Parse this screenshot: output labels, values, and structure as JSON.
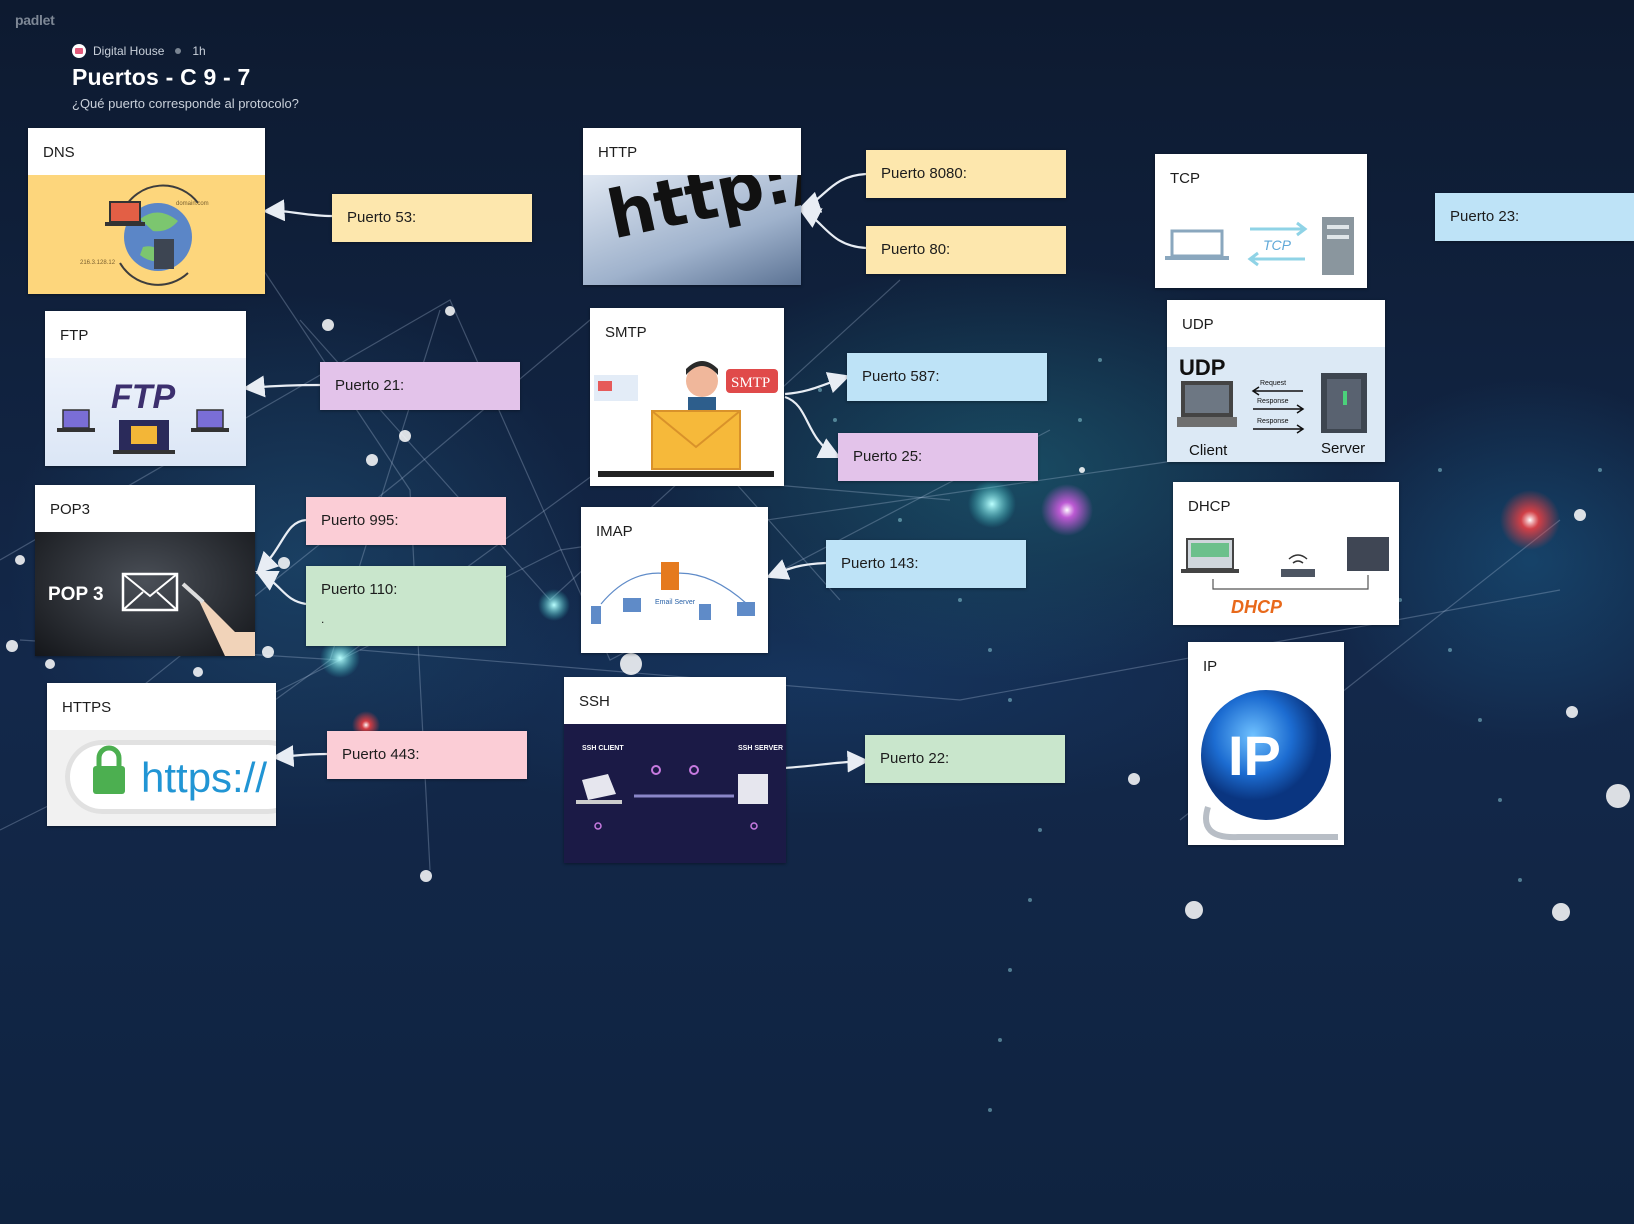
{
  "app": {
    "logo": "padlet"
  },
  "header": {
    "author": "Digital House",
    "time": "1h",
    "title": "Puertos - C 9 - 7",
    "subtitle": "¿Qué puerto corresponde al protocolo?"
  },
  "cards": {
    "dns": {
      "title": "DNS",
      "img_domain": "domain.com",
      "img_ip": "216.3.128.12"
    },
    "http": {
      "title": "HTTP",
      "img_text": "http://www"
    },
    "tcp": {
      "title": "TCP",
      "img_text": "TCP"
    },
    "ftp": {
      "title": "FTP",
      "img_text": "FTP"
    },
    "smtp": {
      "title": "SMTP",
      "img_text": "SMTP"
    },
    "udp": {
      "title": "UDP",
      "img_heading": "UDP",
      "img_client": "Client",
      "img_server": "Server",
      "img_request": "Request",
      "img_response": "Response"
    },
    "pop3": {
      "title": "POP3",
      "img_text": "POP 3"
    },
    "imap": {
      "title": "IMAP",
      "img_text": "Email Server"
    },
    "dhcp": {
      "title": "DHCP",
      "img_text": "DHCP"
    },
    "ip": {
      "title": "IP",
      "img_text": "IP"
    },
    "https": {
      "title": "HTTPS",
      "img_text": "https://"
    },
    "ssh": {
      "title": "SSH",
      "img_client": "SSH CLIENT",
      "img_server": "SSH SERVER"
    }
  },
  "notes": {
    "p53": "Puerto 53:",
    "p8080": "Puerto 8080:",
    "p80": "Puerto 80:",
    "p23": "Puerto 23:",
    "p21": "Puerto 21:",
    "p587": "Puerto 587:",
    "p25": "Puerto 25:",
    "p995": "Puerto 995:",
    "p110": "Puerto 110:",
    "p110_extra": ".",
    "p143": "Puerto 143:",
    "p443": "Puerto 443:",
    "p22": "Puerto 22:"
  },
  "colors": {
    "yellow": "#fde7ad",
    "blue": "#bee3f7",
    "purple": "#e3c3ea",
    "pink": "#fbcdd6",
    "green": "#c9e6cc"
  }
}
